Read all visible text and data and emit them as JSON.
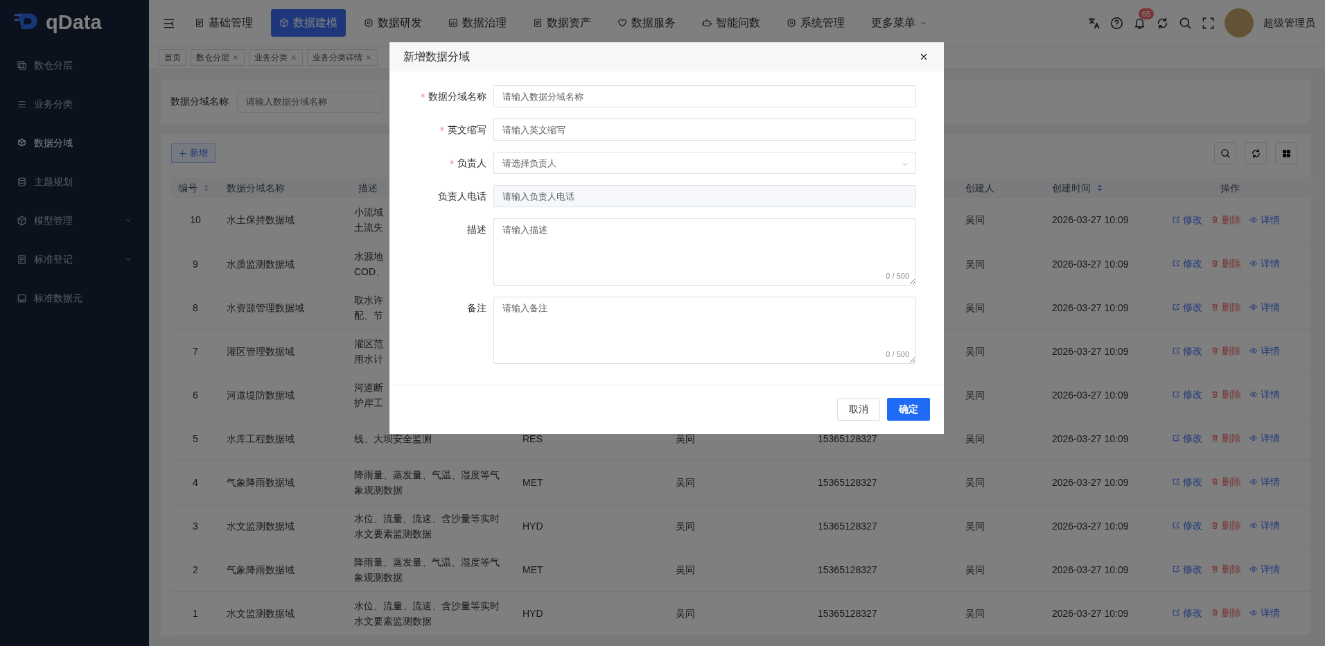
{
  "sidebar": {
    "logo": "qData",
    "items": [
      {
        "label": "数仓分层",
        "selected": false,
        "expandable": false
      },
      {
        "label": "业务分类",
        "selected": false,
        "expandable": false
      },
      {
        "label": "数据分域",
        "selected": true,
        "expandable": false
      },
      {
        "label": "主题规划",
        "selected": false,
        "expandable": false
      },
      {
        "label": "模型管理",
        "selected": false,
        "expandable": true
      },
      {
        "label": "标准登记",
        "selected": false,
        "expandable": true
      },
      {
        "label": "标准数据元",
        "selected": false,
        "expandable": false
      }
    ]
  },
  "topbar": {
    "nav": [
      {
        "label": "基础管理",
        "selected": false,
        "has_caret": false
      },
      {
        "label": "数据建模",
        "selected": true,
        "has_caret": false
      },
      {
        "label": "数据研发",
        "selected": false,
        "has_caret": false
      },
      {
        "label": "数据治理",
        "selected": false,
        "has_caret": false
      },
      {
        "label": "数据资产",
        "selected": false,
        "has_caret": false
      },
      {
        "label": "数据服务",
        "selected": false,
        "has_caret": false
      },
      {
        "label": "智能问数",
        "selected": false,
        "has_caret": false
      },
      {
        "label": "系统管理",
        "selected": false,
        "has_caret": false
      },
      {
        "label": "更多菜单",
        "selected": false,
        "has_caret": true
      }
    ],
    "notification_count": "65",
    "user": "超级管理员"
  },
  "tabs": [
    {
      "label": "首页",
      "closable": false
    },
    {
      "label": "数仓分层",
      "closable": true
    },
    {
      "label": "业务分类",
      "closable": true
    },
    {
      "label": "业务分类详情",
      "closable": true
    }
  ],
  "search": {
    "label": "数据分域名称",
    "placeholder": "请输入数据分域名称"
  },
  "toolbar": {
    "add_label": "新增"
  },
  "table": {
    "columns": [
      {
        "label": "编号",
        "sort_active": false
      },
      {
        "label": "数据分域名称"
      },
      {
        "label": "描述"
      },
      {
        "label": "创建人"
      },
      {
        "label": "创建时间",
        "sort_active": true
      },
      {
        "label": "操作"
      }
    ],
    "rows": [
      {
        "no": "10",
        "name": "水土保持数据域",
        "description": [
          "小流域",
          "土流失"
        ],
        "creator": "吴同",
        "created_at": "2026-03-27 10:09",
        "actions": [
          {
            "kind": "edit",
            "label": "修改"
          },
          {
            "kind": "delete",
            "label": "删除"
          },
          {
            "kind": "view",
            "label": "详情"
          }
        ]
      },
      {
        "no": "9",
        "name": "水质监测数据域",
        "description": [
          "水源地",
          "COD、"
        ],
        "creator": "吴同",
        "created_at": "2026-03-27 10:09",
        "actions": [
          {
            "kind": "edit",
            "label": "修改"
          },
          {
            "kind": "delete",
            "label": "删除"
          },
          {
            "kind": "view",
            "label": "详情"
          }
        ]
      },
      {
        "no": "8",
        "name": "水资源管理数据域",
        "description": [
          "取水许",
          "配、节"
        ],
        "creator": "吴同",
        "created_at": "2026-03-27 10:09",
        "actions": [
          {
            "kind": "edit",
            "label": "修改"
          },
          {
            "kind": "delete",
            "label": "删除"
          },
          {
            "kind": "view",
            "label": "详情"
          }
        ]
      },
      {
        "no": "7",
        "name": "灌区管理数据域",
        "description": [
          "灌区范",
          "用水计"
        ],
        "creator": "吴同",
        "created_at": "2026-03-27 10:09",
        "actions": [
          {
            "kind": "edit",
            "label": "修改"
          },
          {
            "kind": "delete",
            "label": "删除"
          },
          {
            "kind": "view",
            "label": "详情"
          }
        ]
      },
      {
        "no": "6",
        "name": "河道堤防数据域",
        "description": [
          "河道断",
          "护岸工"
        ],
        "creator": "吴同",
        "created_at": "2026-03-27 10:09",
        "actions": [
          {
            "kind": "edit",
            "label": "修改"
          },
          {
            "kind": "delete",
            "label": "删除"
          },
          {
            "kind": "view",
            "label": "详情"
          }
        ]
      },
      {
        "no": "5",
        "name": "水库工程数据域",
        "description": [
          "线、大坝安全监测"
        ],
        "column_4": "RES",
        "column_5": "吴同",
        "column_6": "15365128327",
        "creator": "吴同",
        "created_at": "2026-03-27 10:09",
        "actions": [
          {
            "kind": "edit",
            "label": "修改"
          },
          {
            "kind": "delete",
            "label": "删除"
          },
          {
            "kind": "view",
            "label": "详情"
          }
        ]
      },
      {
        "no": "4",
        "name": "气象降雨数据域",
        "description": [
          "降雨量、蒸发量、气温、湿度等气",
          "象观测数据"
        ],
        "column_4": "MET",
        "column_5": "吴同",
        "column_6": "15365128327",
        "creator": "吴同",
        "created_at": "2026-03-27 10:09",
        "actions": [
          {
            "kind": "edit",
            "label": "修改"
          },
          {
            "kind": "delete",
            "label": "删除"
          },
          {
            "kind": "view",
            "label": "详情"
          }
        ]
      },
      {
        "no": "3",
        "name": "水文监测数据域",
        "description": [
          "水位、流量、流速、含沙量等实时",
          "水文要素监测数据"
        ],
        "column_4": "HYD",
        "column_5": "吴同",
        "column_6": "15365128327",
        "creator": "吴同",
        "created_at": "2026-03-27 10:09",
        "actions": [
          {
            "kind": "edit",
            "label": "修改"
          },
          {
            "kind": "delete",
            "label": "删除"
          },
          {
            "kind": "view",
            "label": "详情"
          }
        ]
      },
      {
        "no": "2",
        "name": "气象降雨数据域",
        "description": [
          "降雨量、蒸发量、气温、湿度等气",
          "象观测数据"
        ],
        "column_4": "MET",
        "column_5": "吴同",
        "column_6": "15365128327",
        "creator": "吴同",
        "created_at": "2026-03-27 10:09",
        "actions": [
          {
            "kind": "edit",
            "label": "修改"
          },
          {
            "kind": "delete",
            "label": "删除"
          },
          {
            "kind": "view",
            "label": "详情"
          }
        ]
      },
      {
        "no": "1",
        "name": "水文监测数据域",
        "description": [
          "水位、流量、流速、含沙量等实时",
          "水文要素监测数据"
        ],
        "column_4": "HYD",
        "column_5": "吴同",
        "column_6": "15365128327",
        "creator": "吴同",
        "created_at": "2026-03-27 10:09",
        "actions": [
          {
            "kind": "edit",
            "label": "修改"
          },
          {
            "kind": "delete",
            "label": "删除"
          },
          {
            "kind": "view",
            "label": "详情"
          }
        ]
      }
    ]
  },
  "dialog": {
    "title": "新增数据分域",
    "fields": [
      {
        "kind": "input",
        "label": "数据分域名称",
        "required": true,
        "placeholder": "请输入数据分域名称"
      },
      {
        "kind": "input",
        "label": "英文缩写",
        "required": true,
        "placeholder": "请输入英文缩写"
      },
      {
        "kind": "select",
        "label": "负责人",
        "required": true,
        "placeholder": "请选择负责人"
      },
      {
        "kind": "input",
        "label": "负责人电话",
        "required": false,
        "placeholder": "请输入负责人电话",
        "disabled": true
      },
      {
        "kind": "textarea",
        "label": "描述",
        "required": false,
        "placeholder": "请输入描述",
        "counter": "0 / 500"
      },
      {
        "kind": "textarea",
        "label": "备注",
        "required": false,
        "placeholder": "请输入备注",
        "counter": "0 / 500"
      }
    ],
    "buttons": [
      {
        "kind": "secondary",
        "label": "取消"
      },
      {
        "kind": "primary",
        "label": "确定"
      }
    ]
  }
}
